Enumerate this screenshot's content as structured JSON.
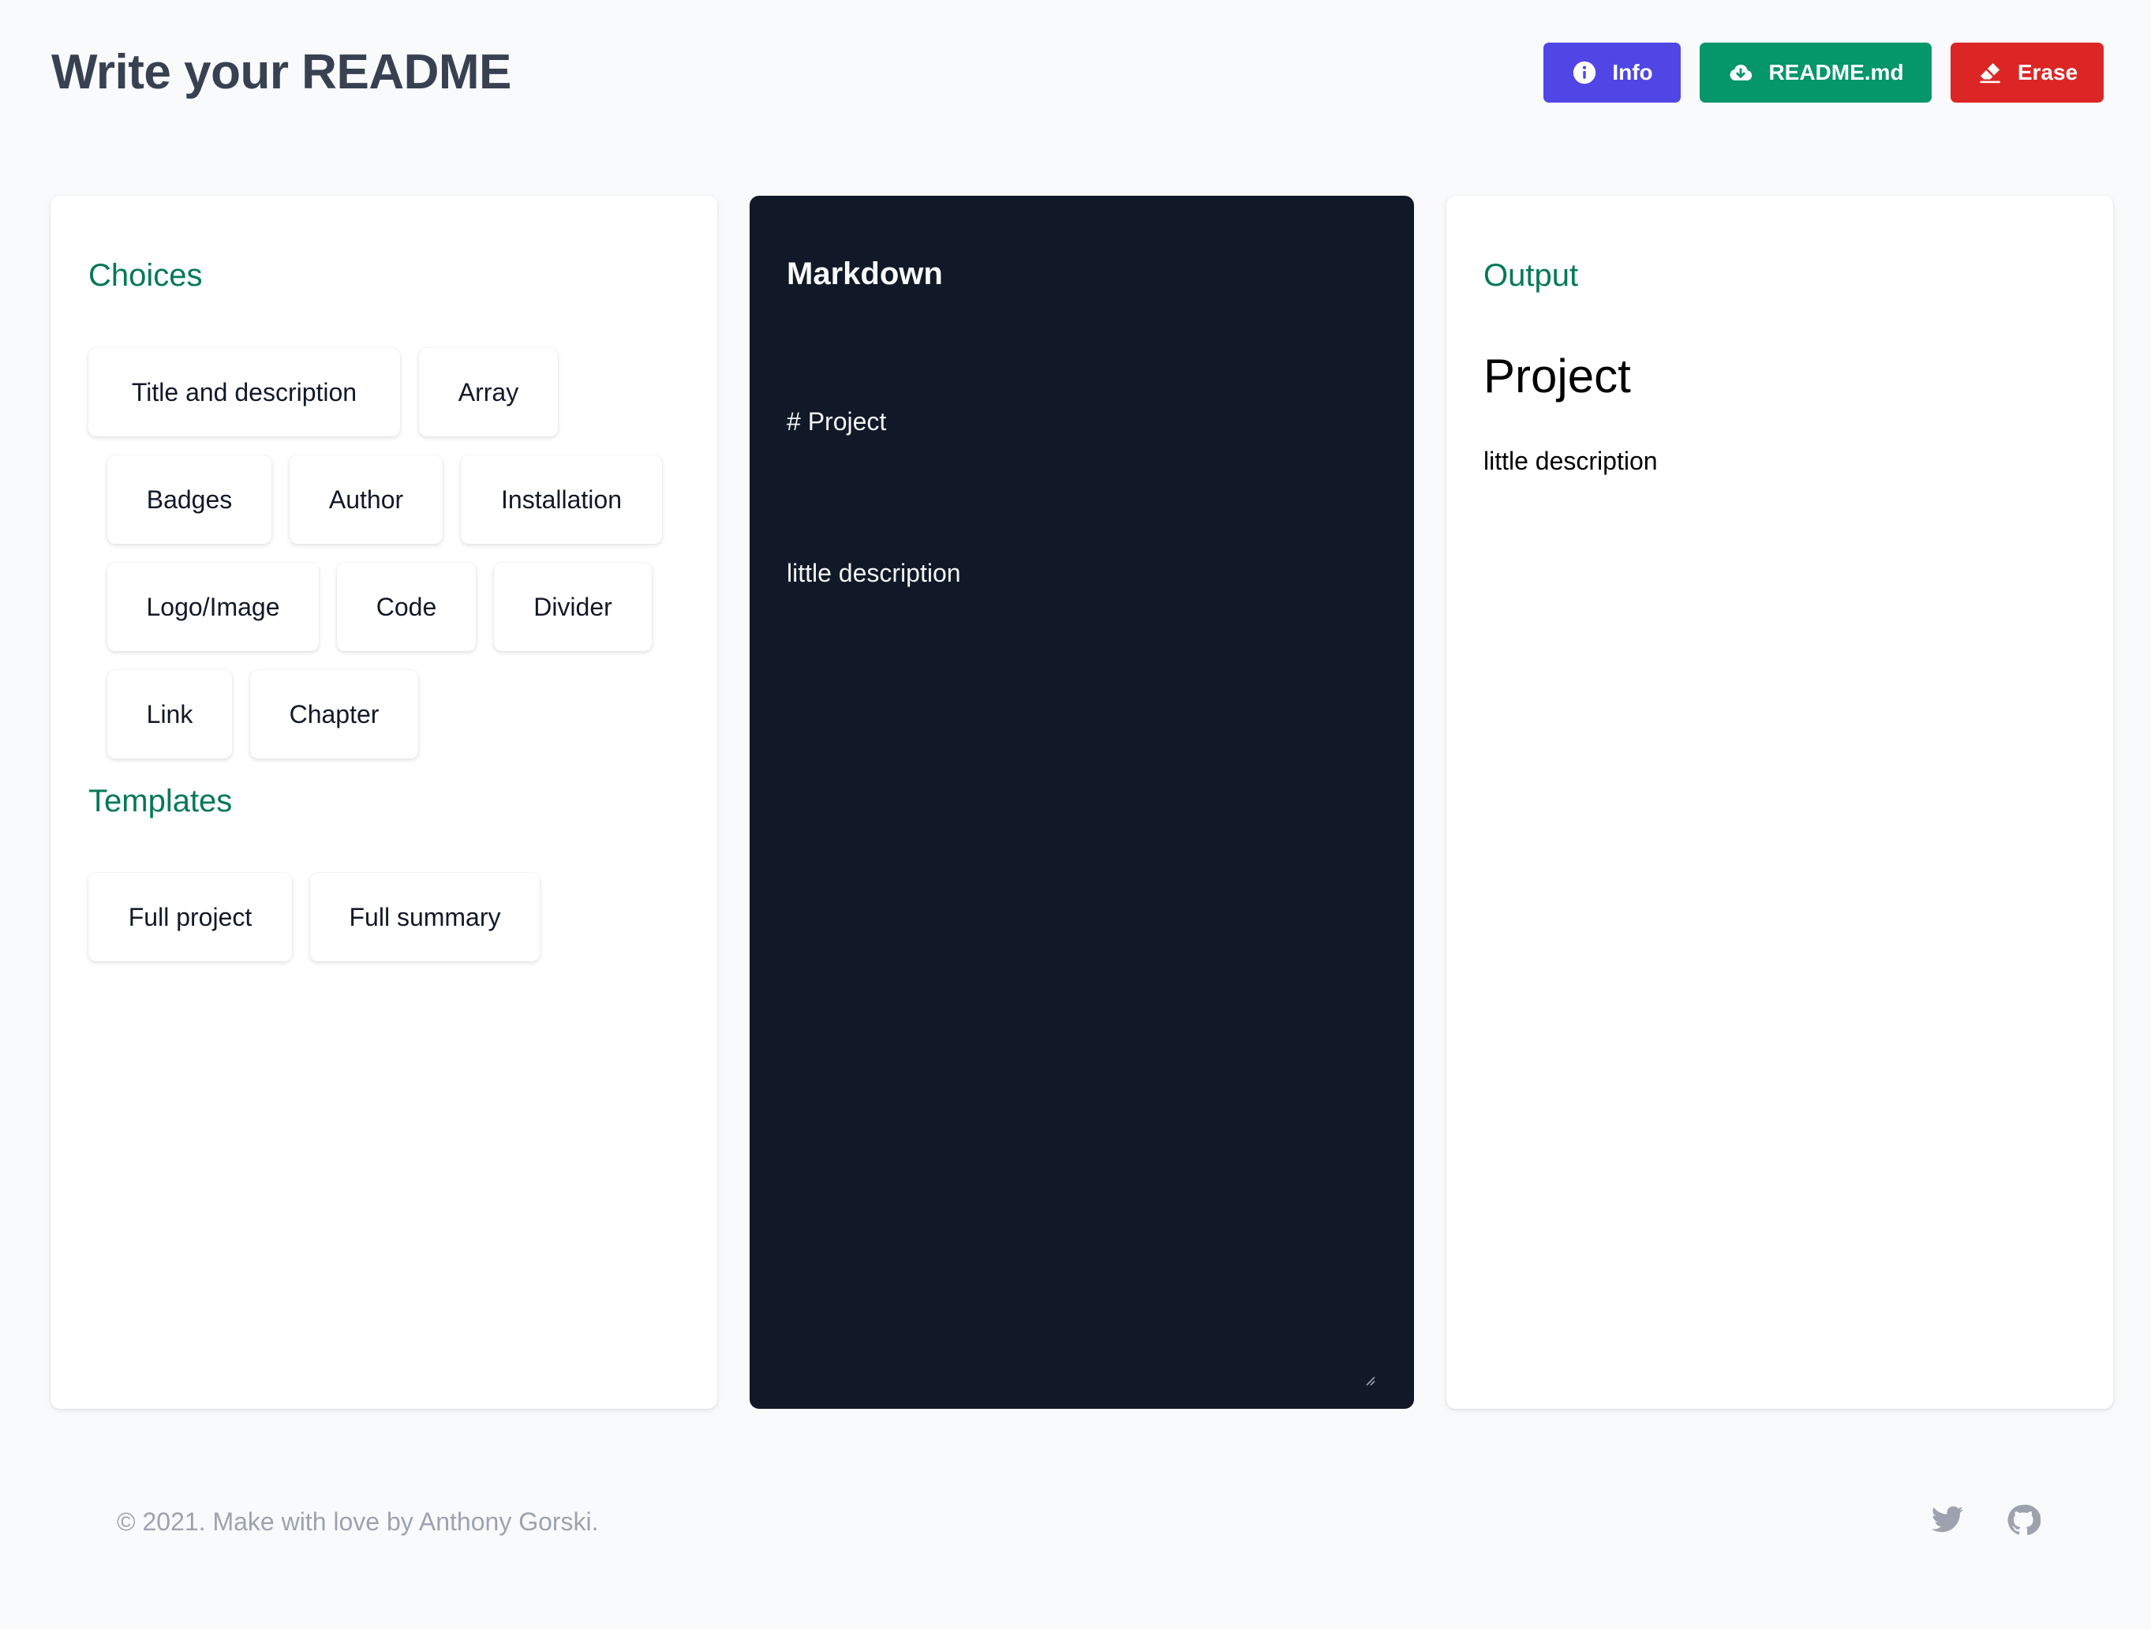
{
  "header": {
    "title": "Write your README",
    "buttons": {
      "info": "Info",
      "readme": "README.md",
      "erase": "Erase"
    },
    "colors": {
      "info": "#4f46e5",
      "readme": "#059669",
      "erase": "#dc2626"
    }
  },
  "choices": {
    "title": "Choices",
    "items": [
      "Title and description",
      "Array",
      "Badges",
      "Author",
      "Installation",
      "Logo/Image",
      "Code",
      "Divider",
      "Link",
      "Chapter"
    ]
  },
  "templates": {
    "title": "Templates",
    "items": [
      "Full project",
      "Full summary"
    ]
  },
  "markdown": {
    "title": "Markdown",
    "lines": [
      "# Project",
      "little description"
    ]
  },
  "output": {
    "title": "Output",
    "heading": "Project",
    "paragraph": "little description"
  },
  "footer": {
    "text": "© 2021. Make with love by Anthony Gorski.",
    "icons": [
      "twitter-icon",
      "github-icon"
    ]
  }
}
